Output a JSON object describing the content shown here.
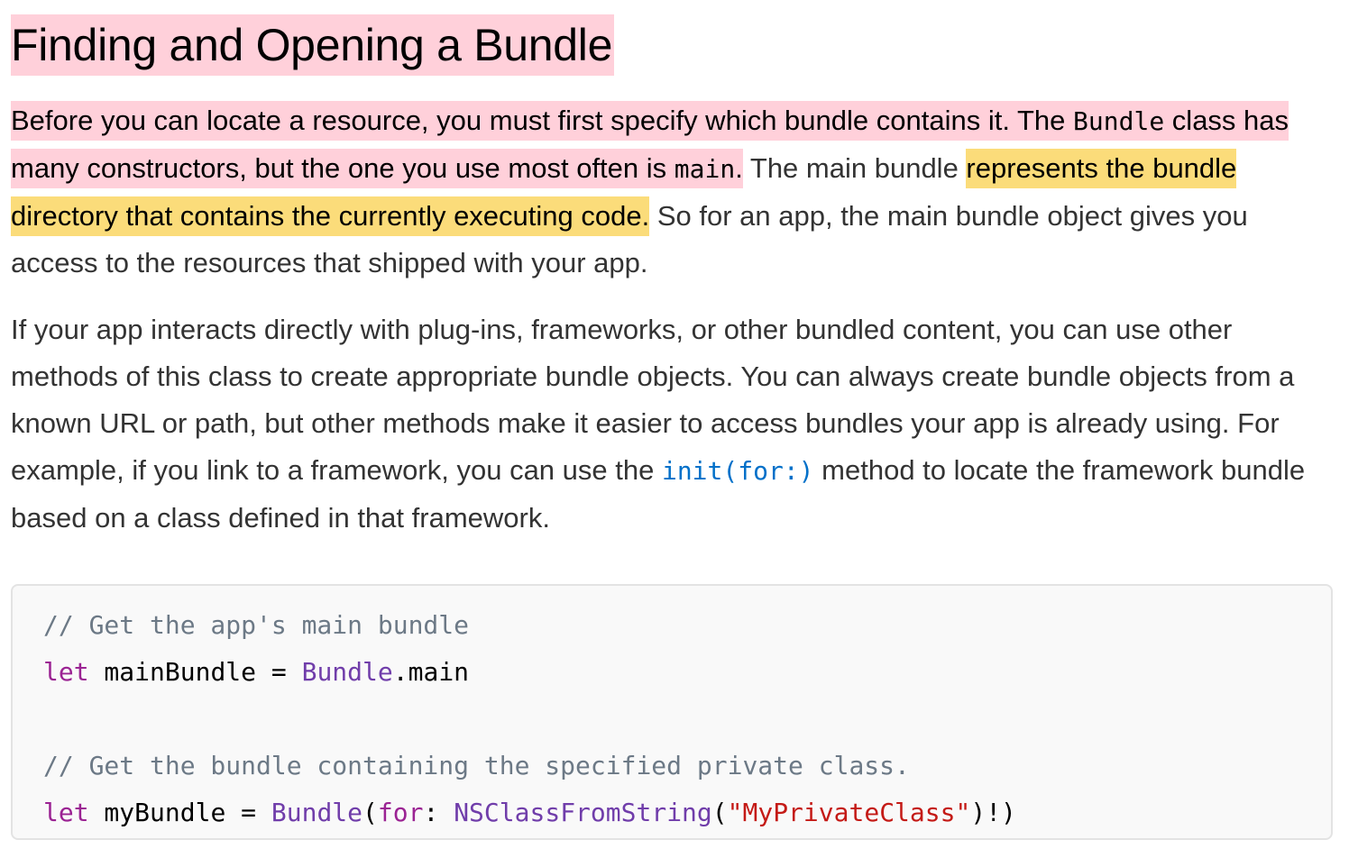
{
  "article": {
    "heading": "Finding and Opening a Bundle",
    "paragraph1": {
      "s1_pre": "Before you can locate a resource, you must first specify which bundle contains it. The ",
      "s1_code": "Bundle",
      "s1_mid": " class has many constructors, but the one you use most often is ",
      "s1_code2": "main",
      "s1_end": ".",
      "s2_pre": " The main bundle ",
      "s2_highlight": "represents the bundle directory that contains the currently executing code.",
      "s3": " So for an app, the main bundle object gives you access to the resources that shipped with your app."
    },
    "paragraph2": {
      "pre": "If your app interacts directly with plug-ins, frameworks, or other bundled content, you can use other methods of this class to create appropriate bundle objects. You can always create bundle objects from a known URL or path, but other methods make it easier to access bundles your app is already using. For example, if you link to a framework, you can use the ",
      "link": "init(for:)",
      "post": " method to locate the framework bundle based on a class defined in that framework."
    },
    "highlight_colors": {
      "pink": "#ffd0da",
      "yellow": "#fbdc7a"
    }
  },
  "code_listing": {
    "line1_comment": "// Get the app's main bundle",
    "line2_kw": "let",
    "line2_var": " mainBundle = ",
    "line2_type": "Bundle",
    "line2_rest": ".main",
    "line4_comment": "// Get the bundle containing the specified private class.",
    "line5_kw": "let",
    "line5_var": " myBundle = ",
    "line5_type": "Bundle",
    "line5_paren": "(",
    "line5_for": "for",
    "line5_colon": ": ",
    "line5_func": "NSClassFromString",
    "line5_open": "(",
    "line5_string": "\"MyPrivateClass\"",
    "line5_close": ")!)"
  }
}
